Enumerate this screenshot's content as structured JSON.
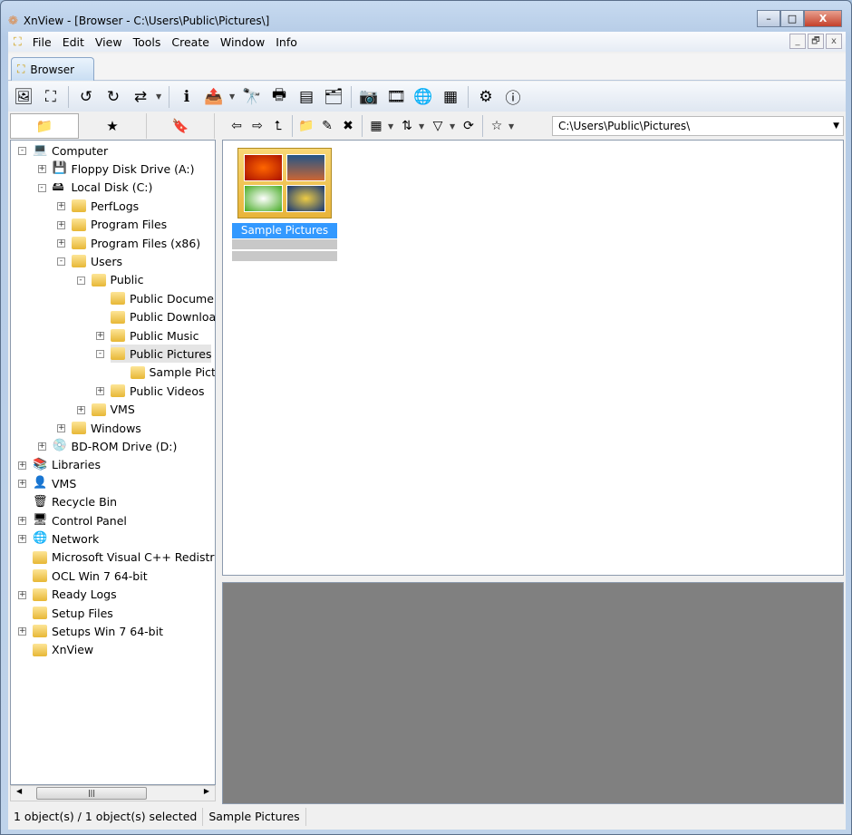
{
  "window": {
    "title": "XnView - [Browser - C:\\Users\\Public\\Pictures\\]",
    "minimize": "–",
    "maximize": "□",
    "close": "X"
  },
  "menu": [
    "File",
    "Edit",
    "View",
    "Tools",
    "Create",
    "Window",
    "Info"
  ],
  "mdi": [
    "_",
    "🗗",
    "x"
  ],
  "tabs": [
    {
      "label": "Browser"
    }
  ],
  "toolbar": [
    [
      "open-image-icon",
      "🖼"
    ],
    [
      "fullscreen-icon",
      "⛶"
    ],
    [
      "sep"
    ],
    [
      "rotate-left-icon",
      "↺"
    ],
    [
      "rotate-right-icon",
      "↻"
    ],
    [
      "convert-icon",
      "⇄",
      "dd"
    ],
    [
      "sep"
    ],
    [
      "properties-icon",
      "ℹ"
    ],
    [
      "export-icon",
      "📤",
      "dd"
    ],
    [
      "find-icon",
      "🔭"
    ],
    [
      "print-icon",
      "🖶"
    ],
    [
      "scan-icon",
      "▤"
    ],
    [
      "batch-convert-icon",
      "🗂"
    ],
    [
      "sep"
    ],
    [
      "capture-icon",
      "📷"
    ],
    [
      "slideshow-icon",
      "🎞"
    ],
    [
      "web-icon",
      "🌐"
    ],
    [
      "contact-sheet-icon",
      "▦"
    ],
    [
      "sep"
    ],
    [
      "settings-icon",
      "⚙"
    ],
    [
      "about-icon",
      "ⓘ"
    ]
  ],
  "left_tabs": [
    [
      "folders-tab",
      "📁"
    ],
    [
      "favorites-tab",
      "★"
    ],
    [
      "catalog-tab",
      "🔖"
    ]
  ],
  "nav": [
    [
      "back-icon",
      "⇦"
    ],
    [
      "forward-icon",
      "⇨"
    ],
    [
      "parent-folder-icon",
      "⮤"
    ],
    [
      "sep"
    ],
    [
      "new-folder-icon",
      "📁"
    ],
    [
      "rename-icon",
      "✎"
    ],
    [
      "delete-icon",
      "✖"
    ],
    [
      "sep"
    ],
    [
      "view-mode-icon",
      "▦",
      "dd"
    ],
    [
      "sort-icon",
      "⇅",
      "dd"
    ],
    [
      "filter-icon",
      "▽",
      "dd"
    ],
    [
      "refresh-icon",
      "⟳"
    ],
    [
      "sep"
    ],
    [
      "favorite-icon",
      "☆",
      "dd"
    ]
  ],
  "address": "C:\\Users\\Public\\Pictures\\",
  "tree": [
    [
      "Computer",
      0,
      "-",
      "💻"
    ],
    [
      "Floppy Disk Drive (A:)",
      1,
      "+",
      "💾"
    ],
    [
      "Local Disk (C:)",
      1,
      "-",
      "🖴"
    ],
    [
      "PerfLogs",
      2,
      "+",
      "f"
    ],
    [
      "Program Files",
      2,
      "+",
      "f"
    ],
    [
      "Program Files (x86)",
      2,
      "+",
      "f"
    ],
    [
      "Users",
      2,
      "-",
      "f"
    ],
    [
      "Public",
      3,
      "-",
      "f"
    ],
    [
      "Public Docume",
      4,
      "",
      "f"
    ],
    [
      "Public Downloa",
      4,
      "",
      "f"
    ],
    [
      "Public Music",
      4,
      "+",
      "f"
    ],
    [
      "Public Pictures",
      4,
      "-",
      "f"
    ],
    [
      "Sample Pict",
      5,
      "",
      "f"
    ],
    [
      "Public Videos",
      4,
      "+",
      "f"
    ],
    [
      "VMS",
      3,
      "+",
      "f"
    ],
    [
      "Windows",
      2,
      "+",
      "f"
    ],
    [
      "BD-ROM Drive (D:)",
      1,
      "+",
      "💿"
    ],
    [
      "Libraries",
      0,
      "+",
      "📚"
    ],
    [
      "VMS",
      0,
      "+",
      "👤"
    ],
    [
      "Recycle Bin",
      0,
      "",
      "🗑"
    ],
    [
      "Control Panel",
      0,
      "+",
      "🖥"
    ],
    [
      "Network",
      0,
      "+",
      "🌐"
    ],
    [
      "Microsoft Visual C++ Redistri",
      0,
      "",
      "f"
    ],
    [
      "OCL Win 7 64-bit",
      0,
      "",
      "f"
    ],
    [
      "Ready Logs",
      0,
      "+",
      "f"
    ],
    [
      "Setup Files",
      0,
      "",
      "f"
    ],
    [
      "Setups Win 7 64-bit",
      0,
      "+",
      "f"
    ],
    [
      "XnView",
      0,
      "",
      "f"
    ]
  ],
  "selected_tree_item": "Public Pictures",
  "files": [
    {
      "name": "Sample Pictures",
      "selected": true
    }
  ],
  "status": {
    "count": "1 object(s) / 1 object(s) selected",
    "name": "Sample Pictures"
  },
  "colors": {
    "selection": "#3399ff",
    "preview_bg": "#808080"
  }
}
